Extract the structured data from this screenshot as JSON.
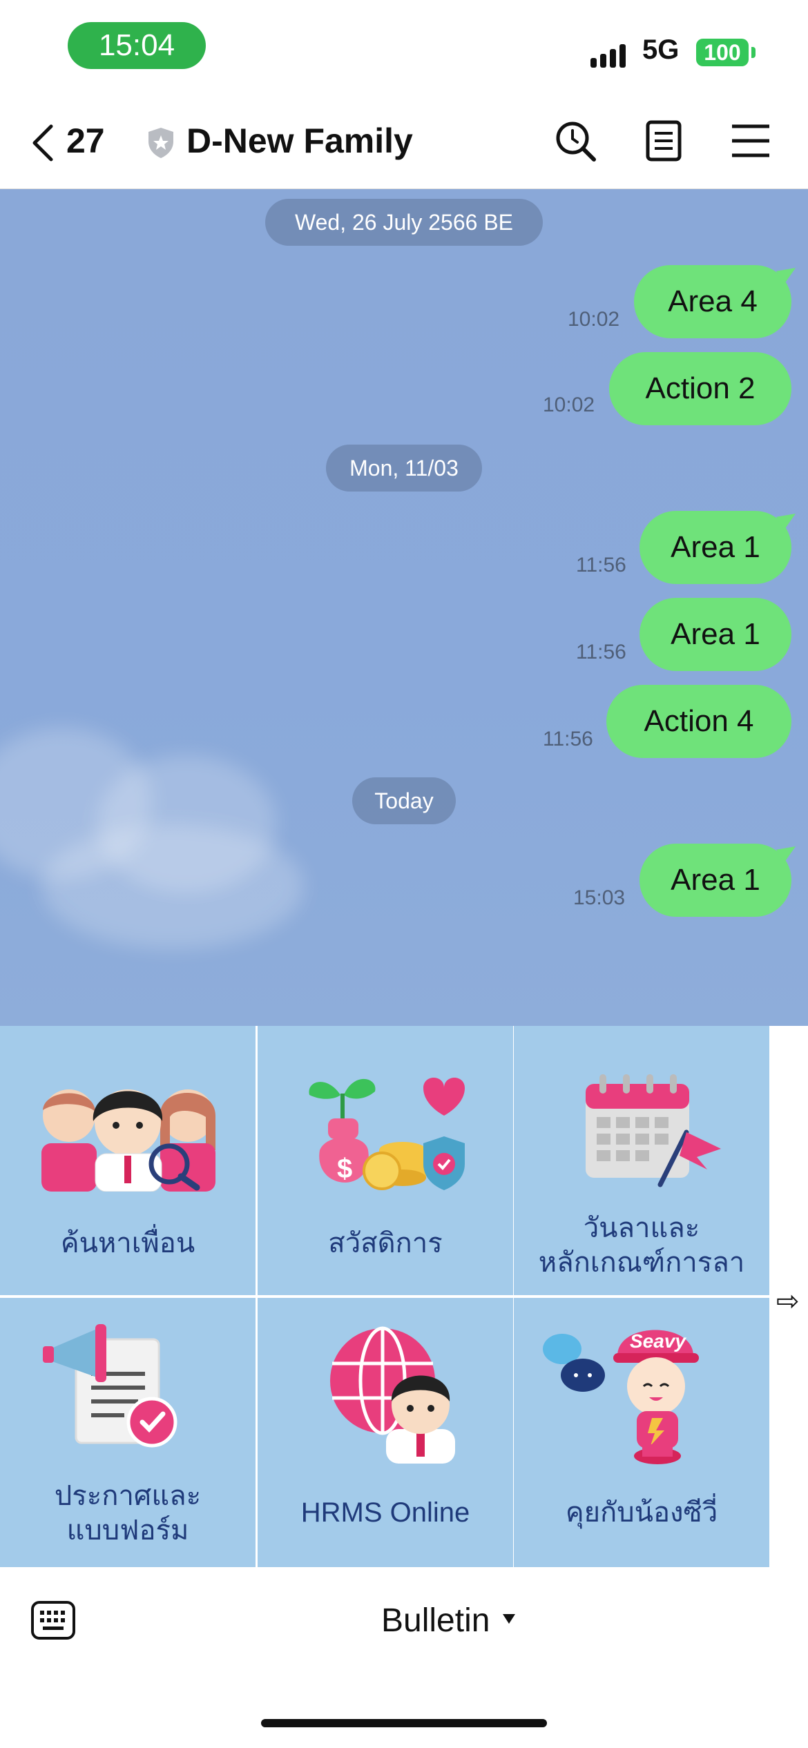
{
  "status_bar": {
    "time": "15:04",
    "network": "5G",
    "battery": "100"
  },
  "header": {
    "back_count": "27",
    "title": "D-New Family"
  },
  "chat": {
    "dates": [
      "Wed, 26 July 2566 BE",
      "Mon, 11/03",
      "Today"
    ],
    "messages": [
      {
        "text": "Area 4",
        "time": "10:02"
      },
      {
        "text": "Action 2",
        "time": "10:02"
      },
      {
        "text": "Area 1",
        "time": "11:56"
      },
      {
        "text": "Area 1",
        "time": "11:56"
      },
      {
        "text": "Action 4",
        "time": "11:56"
      },
      {
        "text": "Area 1",
        "time": "15:03"
      }
    ]
  },
  "rich_menu": {
    "items": [
      {
        "label_line1": "ค้นหาเพื่อน",
        "label_line2": ""
      },
      {
        "label_line1": "สวัสดิการ",
        "label_line2": ""
      },
      {
        "label_line1": "วันลาและ",
        "label_line2": "หลักเกณฑ์การลา"
      },
      {
        "label_line1": "ประกาศและ",
        "label_line2": "แบบฟอร์ม"
      },
      {
        "label_line1": "HRMS Online",
        "label_line2": ""
      },
      {
        "label_line1": "คุยกับน้องซีวี่",
        "label_line2": ""
      }
    ],
    "next_arrow": "⇨"
  },
  "bottom_bar": {
    "menu_label": "Bulletin"
  },
  "colors": {
    "bubble": "#6fe27a",
    "chat_bg": "#8aa8d8",
    "tile_bg": "#a3cbea",
    "accent_pink": "#e83e7d"
  }
}
